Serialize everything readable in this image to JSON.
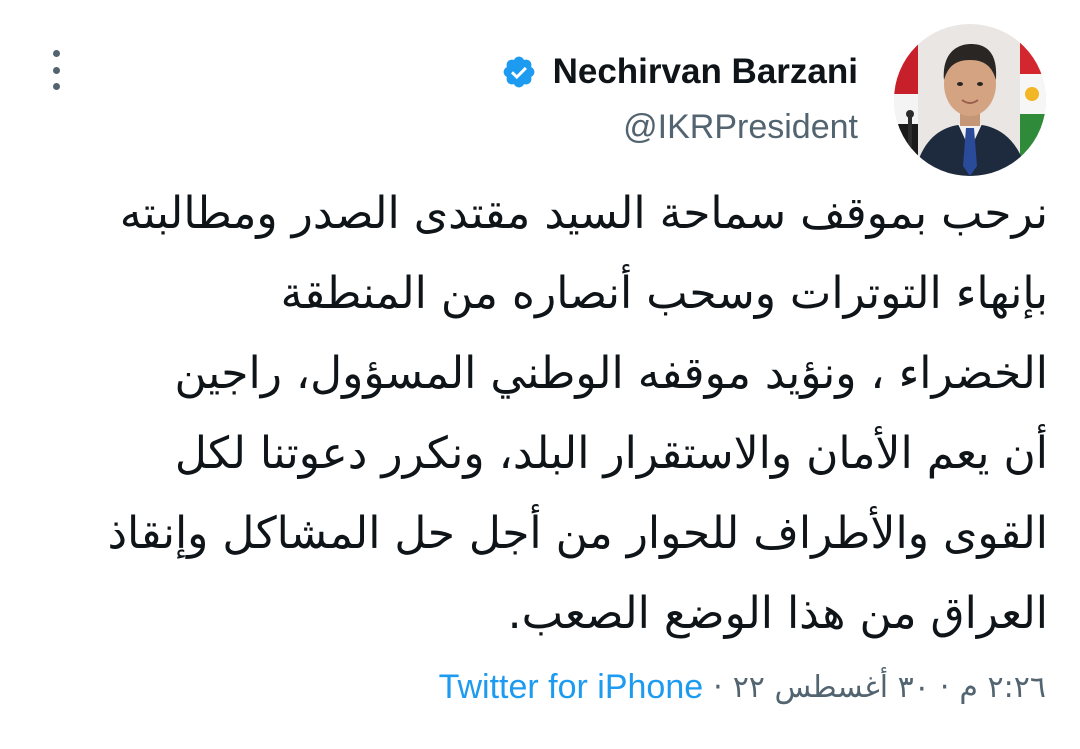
{
  "author": {
    "display_name": "Nechirvan Barzani",
    "handle": "@IKRPresident",
    "verified": true,
    "avatar_icon": "profile-photo"
  },
  "tweet": {
    "lines": [
      "نرحب بموقف سماحة السيد مقتدى الصدر ومطالبته",
      "بإنهاء التوترات وسحب أنصاره من المنطقة",
      "الخضراء ، ونؤيد  موقفه الوطني المسؤول، راجين",
      "أن يعم الأمان والاستقرار البلد، ونكرر دعوتنا لكل",
      "القوى والأطراف للحوار من أجل حل المشاكل وإنقاذ",
      "العراق من هذا الوضع الصعب."
    ]
  },
  "meta": {
    "time": "٢:٢٦ م",
    "date": "٣٠ أغسطس ٢٢",
    "separator": "·",
    "source": "Twitter for iPhone"
  },
  "icons": {
    "more": "more-vertical-icon",
    "verified": "verified-badge-icon"
  },
  "colors": {
    "accent": "#1d9bf0",
    "text": "#0f1419",
    "secondary": "#536471"
  }
}
